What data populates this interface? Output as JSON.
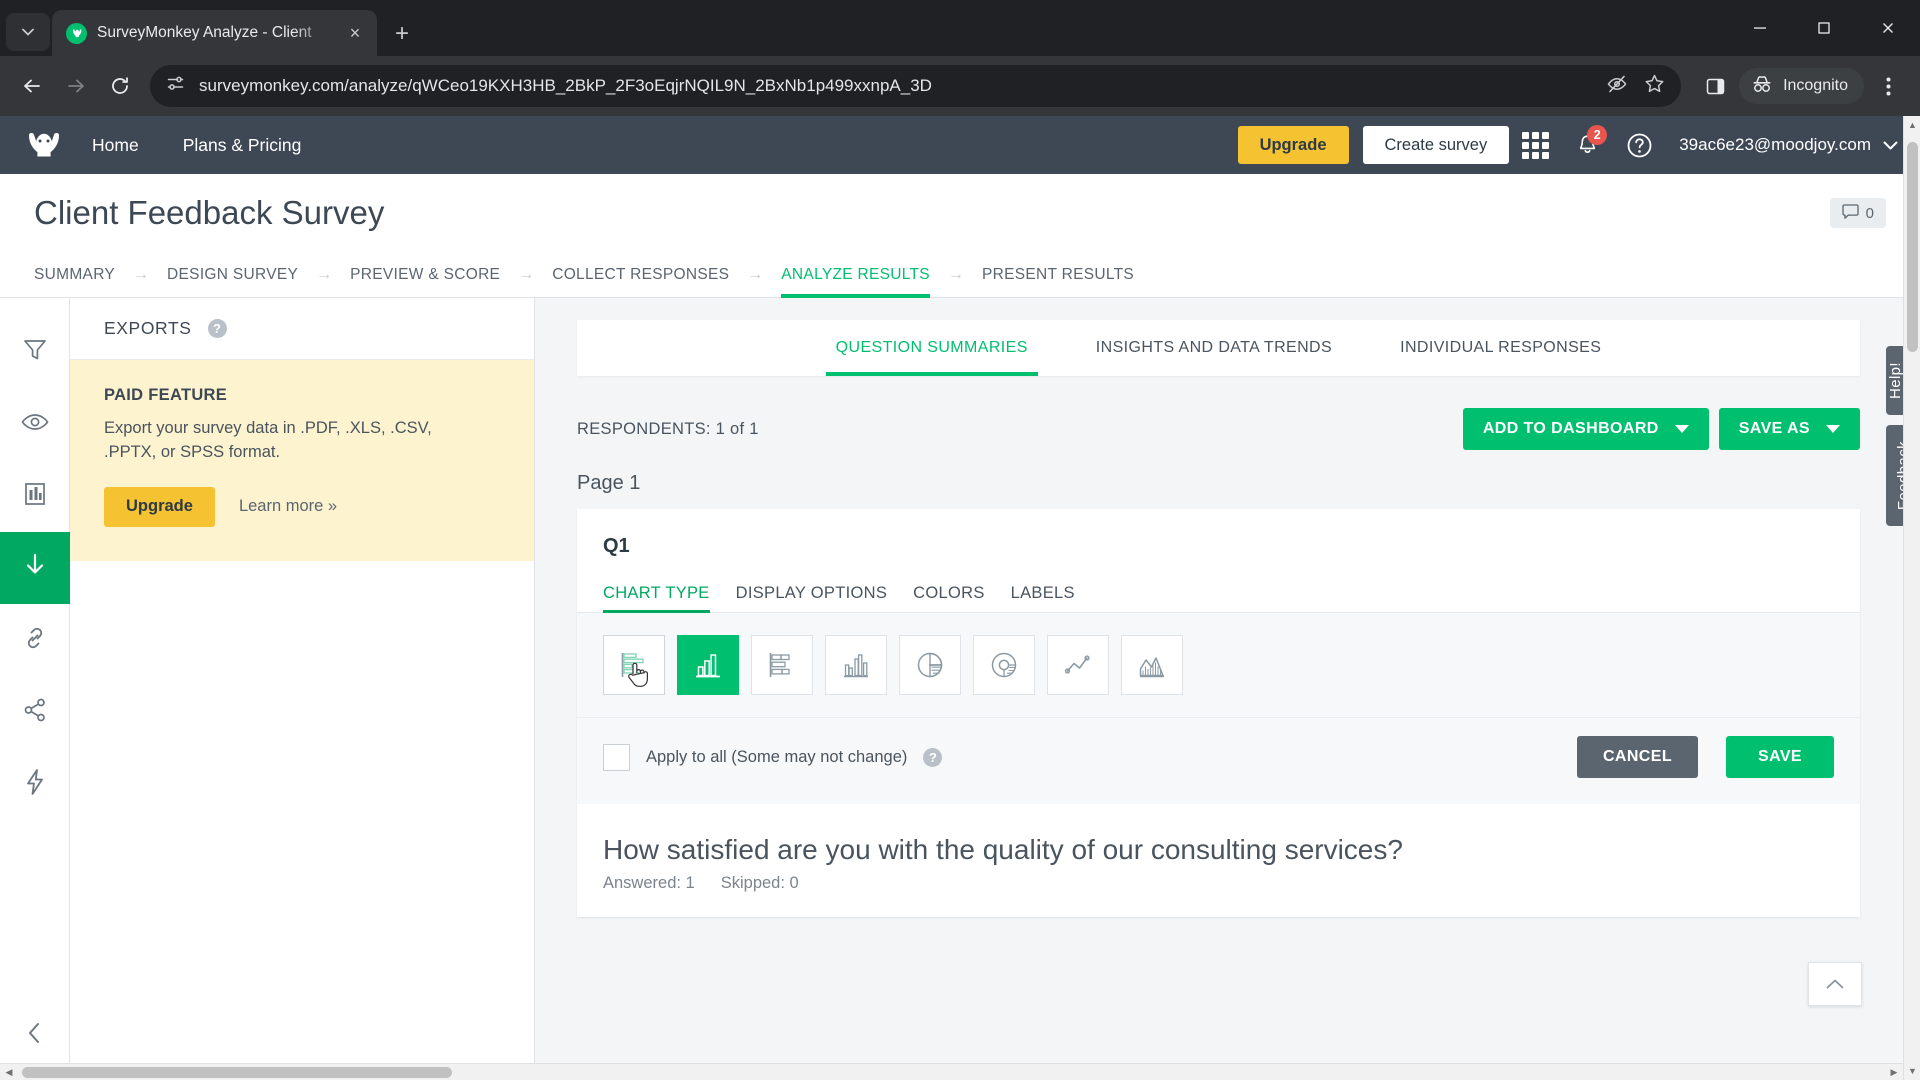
{
  "browser": {
    "tab": {
      "title": "SurveyMonkey Analyze - Client",
      "favicon_icon": "surveymonkey-favicon"
    },
    "new_tab_label": "+",
    "close_tab_label": "×",
    "url": "surveymonkey.com/analyze/qWCeo19KXH3HB_2BkP_2F3oEqjrNQIL9N_2BxNb1p499xxnpA_3D",
    "profile_label": "Incognito",
    "icons": {
      "tab_search": "chevron-down-icon",
      "back": "back-arrow-icon",
      "forward": "forward-arrow-icon",
      "reload": "reload-icon",
      "site_info": "site-settings-icon",
      "tracking": "eye-off-icon",
      "bookmark": "star-icon",
      "side_panel": "side-panel-icon",
      "menu": "kebab-menu-icon",
      "minimize": "minimize-icon",
      "maximize": "maximize-icon",
      "close_window": "close-window-icon"
    }
  },
  "sm_nav": {
    "logo_icon": "surveymonkey-logo",
    "links": [
      "Home",
      "Plans & Pricing"
    ],
    "upgrade_label": "Upgrade",
    "create_survey_label": "Create survey",
    "apps_icon": "app-grid-icon",
    "notifications_icon": "bell-icon",
    "notifications_count": "2",
    "help_icon": "help-circle-icon",
    "account_email": "39ac6e23@moodjoy.com",
    "account_caret_icon": "chevron-down-icon"
  },
  "survey": {
    "title": "Client Feedback Survey",
    "comment_icon": "comment-icon",
    "comment_count": "0"
  },
  "crumbs": [
    {
      "label": "SUMMARY",
      "active": false
    },
    {
      "label": "DESIGN SURVEY",
      "active": false
    },
    {
      "label": "PREVIEW & SCORE",
      "active": false
    },
    {
      "label": "COLLECT RESPONSES",
      "active": false
    },
    {
      "label": "ANALYZE RESULTS",
      "active": true
    },
    {
      "label": "PRESENT RESULTS",
      "active": false
    }
  ],
  "rail": [
    {
      "name": "filter",
      "icon": "funnel-icon",
      "active": false
    },
    {
      "name": "show-hide",
      "icon": "eye-icon",
      "active": false
    },
    {
      "name": "compare",
      "icon": "bar-compare-icon",
      "active": false
    },
    {
      "name": "exports",
      "icon": "download-arrow-icon",
      "active": true
    },
    {
      "name": "share-link",
      "icon": "link-icon",
      "active": false
    },
    {
      "name": "share",
      "icon": "share-nodes-icon",
      "active": false
    },
    {
      "name": "integrations",
      "icon": "lightning-bolt-icon",
      "active": false
    }
  ],
  "rail_collapse_icon": "chevron-left-icon",
  "exports_panel": {
    "heading": "EXPORTS",
    "help_icon": "question-mark-icon",
    "paid_title": "PAID FEATURE",
    "paid_desc": "Export your survey data in .PDF, .XLS, .CSV, .PPTX, or SPSS format.",
    "upgrade_label": "Upgrade",
    "learn_more_label": "Learn more »"
  },
  "content_tabs": [
    {
      "label": "QUESTION SUMMARIES",
      "active": true
    },
    {
      "label": "INSIGHTS AND DATA TRENDS",
      "active": false
    },
    {
      "label": "INDIVIDUAL RESPONSES",
      "active": false
    }
  ],
  "respondents": {
    "label": "RESPONDENTS: 1 of 1",
    "add_to_dashboard_label": "ADD TO DASHBOARD",
    "save_as_label": "SAVE AS",
    "caret_icon": "caret-down-icon"
  },
  "page_label": "Page 1",
  "question_card": {
    "number": "Q1",
    "option_tabs": [
      {
        "label": "CHART TYPE",
        "active": true
      },
      {
        "label": "DISPLAY OPTIONS",
        "active": false
      },
      {
        "label": "COLORS",
        "active": false
      },
      {
        "label": "LABELS",
        "active": false
      }
    ],
    "chart_types": [
      {
        "name": "horizontal-bar-chart",
        "icon": "horizontal-bar-icon",
        "state": "hover"
      },
      {
        "name": "vertical-bar-chart",
        "icon": "vertical-bar-icon",
        "state": "selected"
      },
      {
        "name": "stacked-horizontal-bar-chart",
        "icon": "stacked-horizontal-bar-icon",
        "state": "default"
      },
      {
        "name": "grouped-column-chart",
        "icon": "grouped-column-icon",
        "state": "default"
      },
      {
        "name": "pie-chart",
        "icon": "pie-chart-icon",
        "state": "default"
      },
      {
        "name": "donut-chart",
        "icon": "donut-chart-icon",
        "state": "default"
      },
      {
        "name": "line-chart",
        "icon": "line-chart-icon",
        "state": "default"
      },
      {
        "name": "area-chart",
        "icon": "area-chart-icon",
        "state": "default"
      }
    ],
    "apply_to_all_label": "Apply to all (Some may not change)",
    "apply_help_icon": "question-mark-icon",
    "apply_checked": false,
    "cancel_label": "CANCEL",
    "save_label": "SAVE",
    "question_text": "How satisfied are you with the quality of our consulting services?",
    "answered_label": "Answered: 1",
    "skipped_label": "Skipped: 0"
  },
  "side_tabs": [
    {
      "label": "Help!",
      "icon": "question-circle-icon"
    },
    {
      "label": "Feedback",
      "icon": ""
    }
  ],
  "scroll_top_icon": "chevron-up-icon",
  "colors": {
    "brand_green": "#00bf6f",
    "nav_dark": "#3e4855",
    "upgrade_yellow": "#f5c231",
    "paid_bg": "#fdf3cf",
    "badge_red": "#e8554e"
  }
}
